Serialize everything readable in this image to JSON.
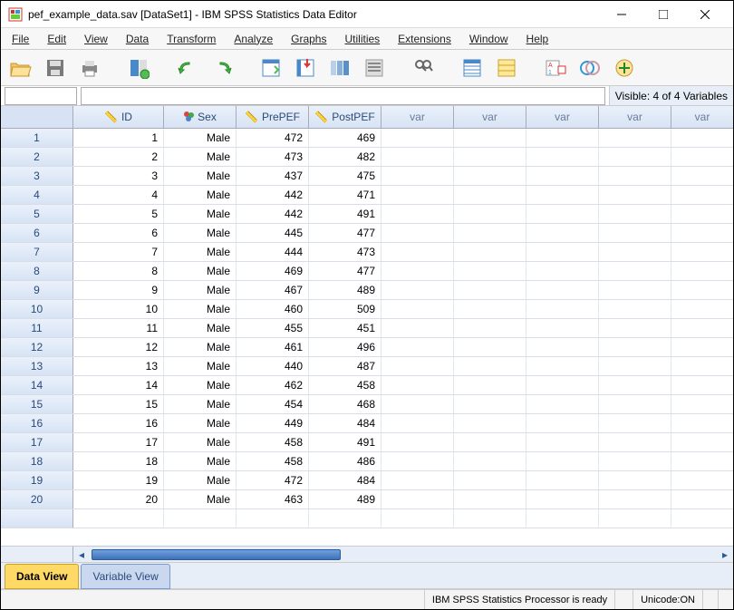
{
  "window": {
    "title": "pef_example_data.sav [DataSet1] - IBM SPSS Statistics Data Editor"
  },
  "menu": [
    "File",
    "Edit",
    "View",
    "Data",
    "Transform",
    "Analyze",
    "Graphs",
    "Utilities",
    "Extensions",
    "Window",
    "Help"
  ],
  "visible_label": "Visible: 4 of 4 Variables",
  "columns": [
    {
      "label": "ID",
      "icon": "ruler"
    },
    {
      "label": "Sex",
      "icon": "nominal"
    },
    {
      "label": "PrePEF",
      "icon": "ruler"
    },
    {
      "label": "PostPEF",
      "icon": "ruler"
    }
  ],
  "empty_col_label": "var",
  "rows": [
    {
      "n": "1",
      "id": "1",
      "sex": "Male",
      "pre": "472",
      "post": "469"
    },
    {
      "n": "2",
      "id": "2",
      "sex": "Male",
      "pre": "473",
      "post": "482"
    },
    {
      "n": "3",
      "id": "3",
      "sex": "Male",
      "pre": "437",
      "post": "475"
    },
    {
      "n": "4",
      "id": "4",
      "sex": "Male",
      "pre": "442",
      "post": "471"
    },
    {
      "n": "5",
      "id": "5",
      "sex": "Male",
      "pre": "442",
      "post": "491"
    },
    {
      "n": "6",
      "id": "6",
      "sex": "Male",
      "pre": "445",
      "post": "477"
    },
    {
      "n": "7",
      "id": "7",
      "sex": "Male",
      "pre": "444",
      "post": "473"
    },
    {
      "n": "8",
      "id": "8",
      "sex": "Male",
      "pre": "469",
      "post": "477"
    },
    {
      "n": "9",
      "id": "9",
      "sex": "Male",
      "pre": "467",
      "post": "489"
    },
    {
      "n": "10",
      "id": "10",
      "sex": "Male",
      "pre": "460",
      "post": "509"
    },
    {
      "n": "11",
      "id": "11",
      "sex": "Male",
      "pre": "455",
      "post": "451"
    },
    {
      "n": "12",
      "id": "12",
      "sex": "Male",
      "pre": "461",
      "post": "496"
    },
    {
      "n": "13",
      "id": "13",
      "sex": "Male",
      "pre": "440",
      "post": "487"
    },
    {
      "n": "14",
      "id": "14",
      "sex": "Male",
      "pre": "462",
      "post": "458"
    },
    {
      "n": "15",
      "id": "15",
      "sex": "Male",
      "pre": "454",
      "post": "468"
    },
    {
      "n": "16",
      "id": "16",
      "sex": "Male",
      "pre": "449",
      "post": "484"
    },
    {
      "n": "17",
      "id": "17",
      "sex": "Male",
      "pre": "458",
      "post": "491"
    },
    {
      "n": "18",
      "id": "18",
      "sex": "Male",
      "pre": "458",
      "post": "486"
    },
    {
      "n": "19",
      "id": "19",
      "sex": "Male",
      "pre": "472",
      "post": "484"
    },
    {
      "n": "20",
      "id": "20",
      "sex": "Male",
      "pre": "463",
      "post": "489"
    }
  ],
  "tabs": {
    "data_view": "Data View",
    "variable_view": "Variable View"
  },
  "status": {
    "processor": "IBM SPSS Statistics Processor is ready",
    "unicode": "Unicode:ON"
  }
}
